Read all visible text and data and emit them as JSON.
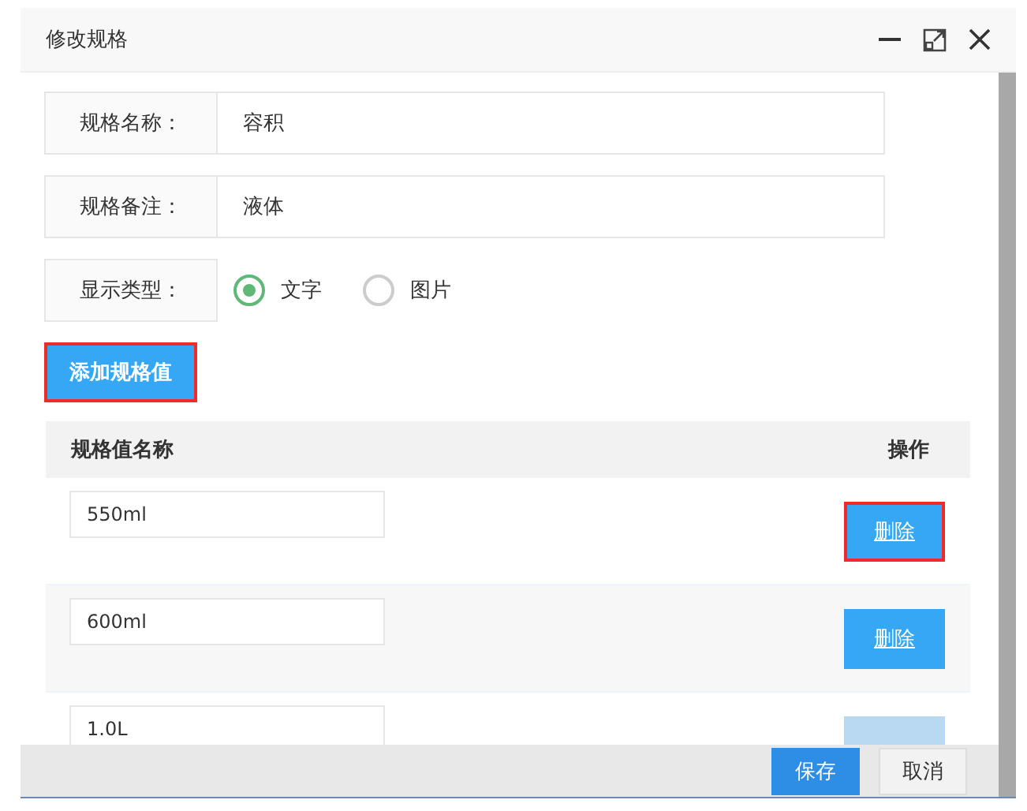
{
  "window": {
    "title": "修改规格"
  },
  "form": {
    "fields": [
      {
        "label": "规格名称：",
        "value": "容积"
      },
      {
        "label": "规格备注：",
        "value": "液体"
      }
    ],
    "type_field": {
      "label": "显示类型：",
      "options": [
        {
          "label": "文字",
          "selected": true
        },
        {
          "label": "图片",
          "selected": false
        }
      ]
    }
  },
  "add_button": {
    "label": "添加规格值",
    "highlighted": true
  },
  "table": {
    "columns": [
      "规格值名称",
      "操作"
    ],
    "rows": [
      {
        "value": "550ml",
        "action": "删除",
        "highlighted": true
      },
      {
        "value": "600ml",
        "action": "删除",
        "highlighted": false
      },
      {
        "value": "1.0L",
        "highlighted": false
      }
    ]
  },
  "footer": {
    "buttons": [
      {
        "label": "保存",
        "kind": "primary"
      },
      {
        "label": "取消",
        "kind": "secondary"
      }
    ]
  }
}
